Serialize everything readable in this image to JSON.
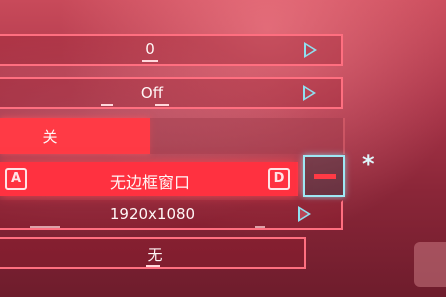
{
  "settings": {
    "row1_value": "0",
    "row2_value": "Off",
    "toggle_on_label": "关",
    "window_mode": {
      "prev_key": "A",
      "value": "无边框窗口",
      "next_key": "D"
    },
    "resolution": "1920x1080",
    "row6_value": "无",
    "marker": "*"
  },
  "icons": {
    "next": "chevron-right-icon",
    "collapse": "minus-icon"
  },
  "colors": {
    "accent_red": "#ff3140",
    "outline_pink": "#ff6f80",
    "accent_cyan": "#9ee8f5"
  }
}
